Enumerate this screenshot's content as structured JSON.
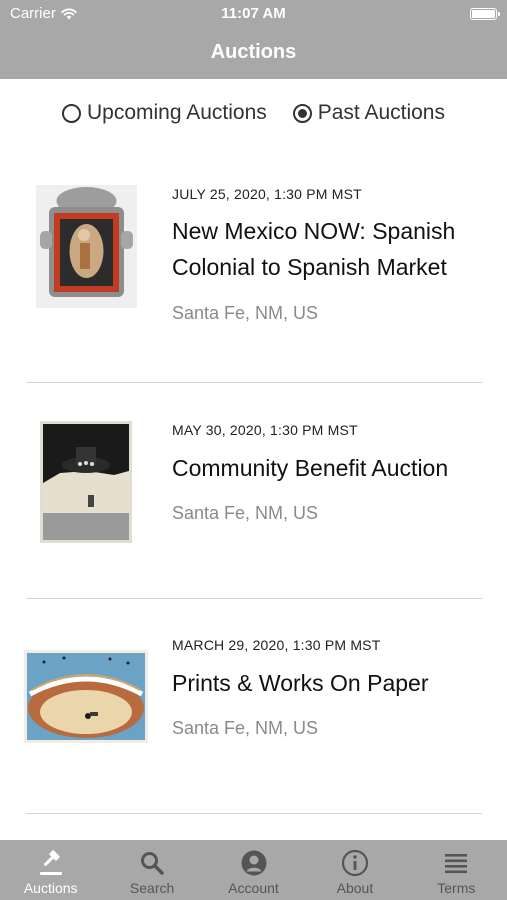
{
  "status_bar": {
    "carrier": "Carrier",
    "time": "11:07 AM"
  },
  "nav": {
    "title": "Auctions"
  },
  "filter": {
    "upcoming_label": "Upcoming Auctions",
    "past_label": "Past Auctions",
    "selected": "past"
  },
  "auctions": [
    {
      "date": "JULY 25, 2020, 1:30 PM MST",
      "title": "New Mexico NOW: Spanish Colonial to Spanish Market",
      "location": "Santa Fe, NM, US"
    },
    {
      "date": "MAY 30, 2020, 1:30 PM MST",
      "title": "Community Benefit Auction",
      "location": "Santa Fe, NM, US"
    },
    {
      "date": "MARCH 29, 2020, 1:30 PM MST",
      "title": "Prints & Works On Paper",
      "location": "Santa Fe, NM, US"
    }
  ],
  "tabs": [
    {
      "label": "Auctions",
      "icon": "gavel-icon",
      "active": true
    },
    {
      "label": "Search",
      "icon": "search-icon",
      "active": false
    },
    {
      "label": "Account",
      "icon": "account-icon",
      "active": false
    },
    {
      "label": "About",
      "icon": "info-icon",
      "active": false
    },
    {
      "label": "Terms",
      "icon": "list-icon",
      "active": false
    }
  ],
  "colors": {
    "bar": "#a8a8a8",
    "tab_active": "#ffffff",
    "tab_inactive": "#555555",
    "location_text": "#8a8a8a"
  }
}
